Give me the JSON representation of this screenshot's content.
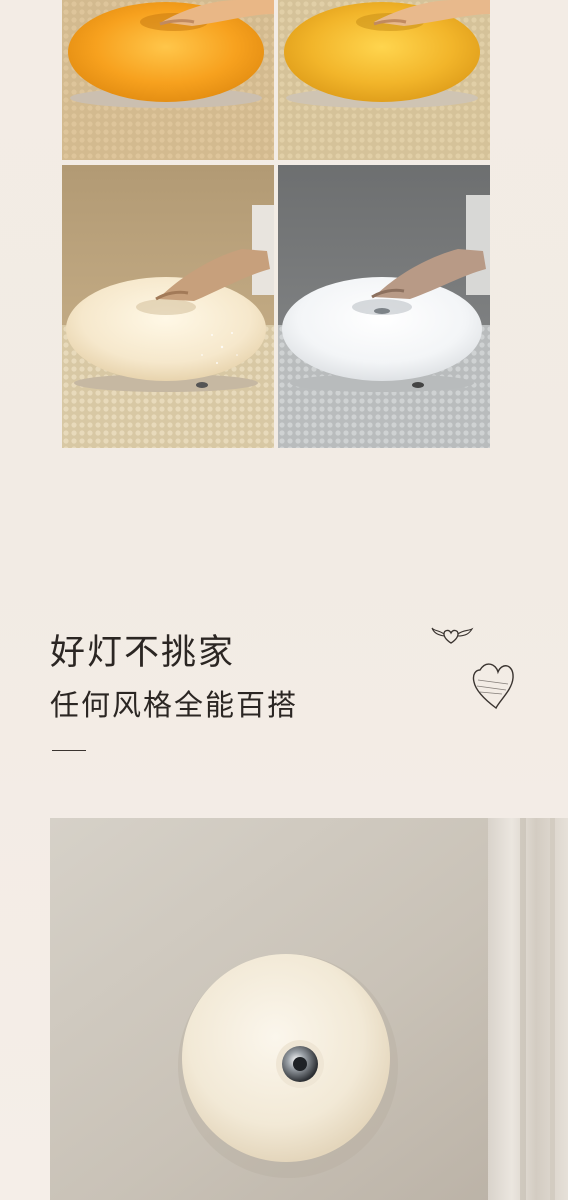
{
  "copy": {
    "headline": "好灯不挑家",
    "subline": "任何风格全能百搭"
  },
  "photos": {
    "grid": [
      {
        "name": "lamp-orange-light",
        "glow_color": "#f5a21c"
      },
      {
        "name": "lamp-amber-light",
        "glow_color": "#f2b52a"
      },
      {
        "name": "lamp-warm-white-light",
        "glow_color": "#f6ead2"
      },
      {
        "name": "lamp-cool-white-light",
        "glow_color": "#f4f6f8"
      }
    ],
    "wall": {
      "name": "wall-mounted-donut-lamp",
      "glow_color": "#f3ead8"
    }
  },
  "colors": {
    "background": "#f3ece5",
    "text": "#2b2623",
    "accent_line": "#3a3430"
  },
  "icons": [
    "winged-heart-icon",
    "heart-icon"
  ]
}
